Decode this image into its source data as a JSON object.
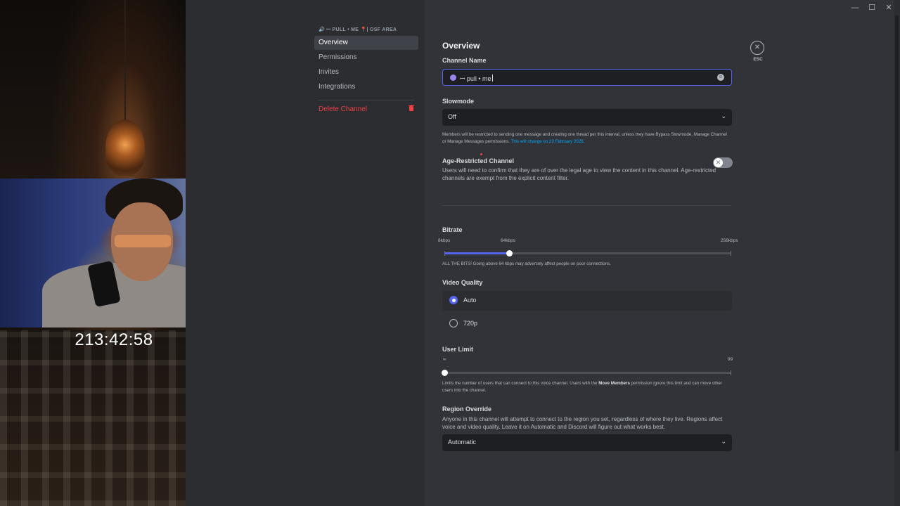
{
  "stream": {
    "timer": "213:42:58"
  },
  "window": {
    "minimize": "—",
    "maximize": "☐",
    "close": "✕"
  },
  "sidebar": {
    "category_header": "🔊 ꟷ PULL • ME 📍| OSF AREA",
    "channel_icon": "🔈",
    "items": [
      {
        "label": "Overview",
        "active": true
      },
      {
        "label": "Permissions"
      },
      {
        "label": "Invites"
      },
      {
        "label": "Integrations"
      }
    ],
    "delete_label": "Delete Channel"
  },
  "page": {
    "title": "Overview",
    "close_label": "ESC"
  },
  "channel_name": {
    "label": "Channel Name",
    "value": "ꟷ pull • me"
  },
  "slowmode": {
    "label": "Slowmode",
    "value": "Off",
    "help": "Members will be restricted to sending one message and creating one thread per this interval, unless they have Bypass Slowmode, Manage Channel or Manage Messages permissions.",
    "help_link": "This will change on 23 February 2026."
  },
  "age_restricted": {
    "label": "Age-Restricted Channel",
    "description": "Users will need to confirm that they are of over the legal age to view the content in this channel. Age-restricted channels are exempt from the explicit content filter.",
    "enabled": false
  },
  "bitrate": {
    "label": "Bitrate",
    "min_label": "8kbps",
    "current_label": "64kbps",
    "max_label": "256kbps",
    "min": 8,
    "max": 256,
    "value": 64,
    "help": "ALL THE BITS! Going above 64 kbps may adversely affect people on poor connections."
  },
  "video_quality": {
    "label": "Video Quality",
    "options": [
      {
        "label": "Auto",
        "selected": true
      },
      {
        "label": "720p",
        "selected": false
      }
    ]
  },
  "user_limit": {
    "label": "User Limit",
    "min_label": "∞",
    "max_label": "99",
    "value": 0,
    "max": 99,
    "help_pre": "Limits the number of users that can connect to this voice channel. Users with the ",
    "help_bold": "Move Members",
    "help_post": " permission ignore this limit and can move other users into the channel."
  },
  "region_override": {
    "label": "Region Override",
    "description": "Anyone in this channel will attempt to connect to the region you set, regardless of where they live. Regions affect voice and video quality. Leave it on Automatic and Discord will figure out what works best.",
    "value": "Automatic"
  },
  "colors": {
    "accent": "#5865f2",
    "danger": "#f23f43",
    "link": "#00a8fc"
  },
  "icons": {
    "trash": "trash-icon",
    "chevron": "chevron-down-icon",
    "close": "close-icon",
    "emoji": "emoji-icon"
  }
}
